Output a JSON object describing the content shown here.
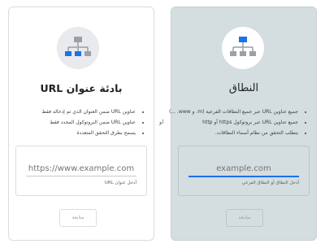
{
  "or_label": "او",
  "domain_option": {
    "icon": "network-tree-icon",
    "title": "النطاق",
    "bullets": [
      "جميع عناوين URL عبر جميع النطاقات الفرعية (m. و www. ...)",
      "جميع عناوين URL عبر بروتوكول https أو http",
      "يتطلب التحقق من نظام أسماء النطاقات."
    ],
    "input_placeholder": "example.com",
    "helper_text": "أدخل النطاق أو النطاق الفرعي",
    "continue_label": "متابعة"
  },
  "url_prefix_option": {
    "icon": "network-tree-icon",
    "title": "بادئة عنوان URL",
    "bullets": [
      "عناوين URL ضمن العنوان الذي تم إدخاله فقط",
      "عناوين URL ضمن البروتوكول المحدد فقط",
      "يسمح بطرق التحقق المتعددة"
    ],
    "input_placeholder": "https://www.example.com",
    "helper_text": "أدخل عنوان URL",
    "continue_label": "متابعة"
  },
  "colors": {
    "accent": "#1a73e8",
    "selected_card_bg": "#d4dde0",
    "icon_gray": "#9aa0a6"
  }
}
